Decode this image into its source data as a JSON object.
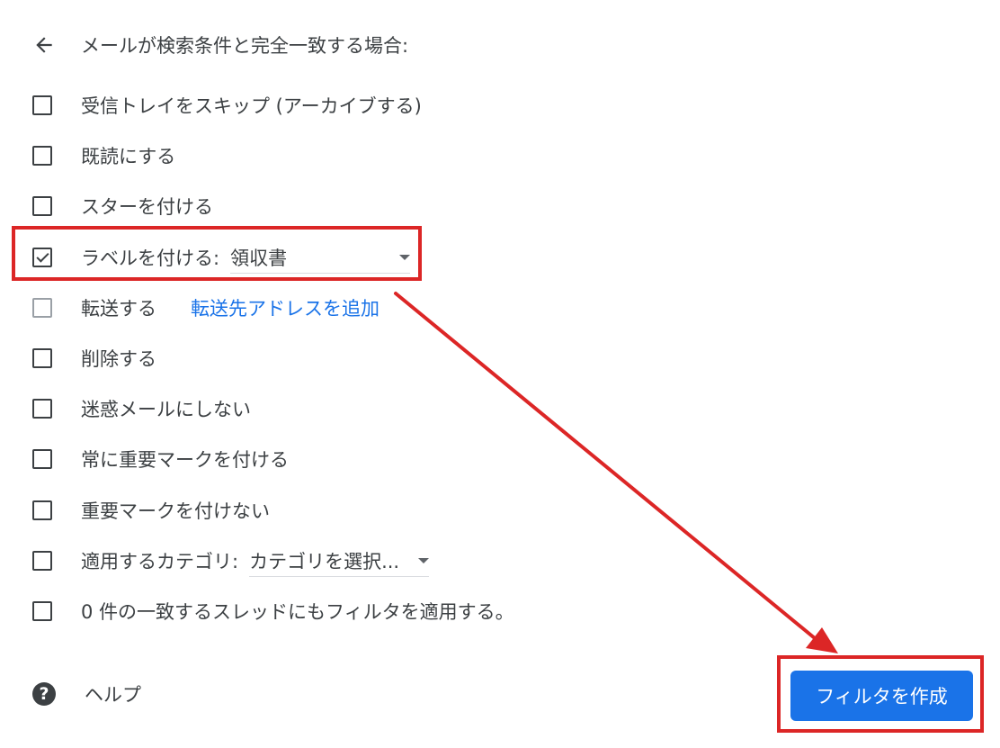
{
  "header": {
    "title": "メールが検索条件と完全一致する場合:"
  },
  "options": {
    "skip_inbox": {
      "label": "受信トレイをスキップ (アーカイブする)",
      "checked": false
    },
    "mark_read": {
      "label": "既読にする",
      "checked": false
    },
    "star": {
      "label": "スターを付ける",
      "checked": false
    },
    "apply_label": {
      "label": "ラベルを付ける:",
      "checked": true,
      "selected": "領収書"
    },
    "forward": {
      "label": "転送する",
      "checked": false,
      "disabled": true,
      "link": "転送先アドレスを追加"
    },
    "delete": {
      "label": "削除する",
      "checked": false
    },
    "never_spam": {
      "label": "迷惑メールにしない",
      "checked": false
    },
    "always_important": {
      "label": "常に重要マークを付ける",
      "checked": false
    },
    "never_important": {
      "label": "重要マークを付けない",
      "checked": false
    },
    "category": {
      "label": "適用するカテゴリ:",
      "checked": false,
      "selected": "カテゴリを選択..."
    },
    "apply_existing": {
      "label": "0 件の一致するスレッドにもフィルタを適用する。",
      "checked": false
    }
  },
  "footer": {
    "help_label": "ヘルプ",
    "create_button": "フィルタを作成"
  },
  "colors": {
    "accent": "#1a73e8",
    "annotation": "#dc2626",
    "text": "#3c4043"
  }
}
